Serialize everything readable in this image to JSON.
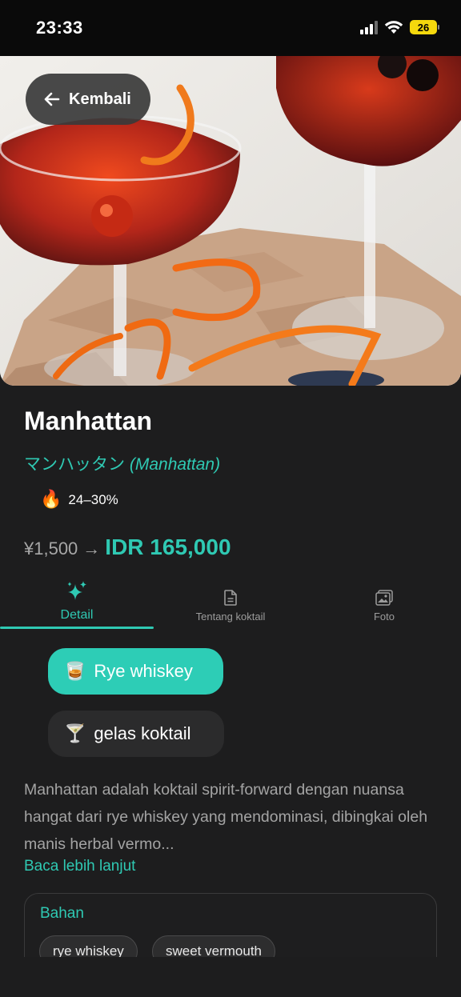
{
  "status_bar": {
    "time": "23:33",
    "battery": "26"
  },
  "back_button": {
    "label": "Kembali"
  },
  "drink": {
    "name": "Manhattan",
    "name_jp": "マンハッタン",
    "name_en": "(Manhattan)",
    "abv": "24–30%",
    "abv_icon": "🔥"
  },
  "price": {
    "original": "¥1,500",
    "arrow": "→",
    "converted": "IDR 165,000"
  },
  "tabs": [
    {
      "label": "Detail",
      "icon": "sparkles-icon",
      "active": true
    },
    {
      "label": "Tentang koktail",
      "icon": "document-icon",
      "active": false
    },
    {
      "label": "Foto",
      "icon": "photo-icon",
      "active": false
    }
  ],
  "chips": {
    "base_spirit": {
      "emoji": "🥃",
      "label": "Rye whiskey"
    },
    "glass": {
      "emoji": "🍸",
      "label": "gelas koktail"
    }
  },
  "description": "Manhattan adalah koktail spirit-forward dengan nuansa hangat dari rye whiskey yang mendominasi, dibingkai oleh manis herbal vermo...",
  "read_more": "Baca lebih lanjut",
  "ingredients": {
    "title": "Bahan",
    "items": [
      "rye whiskey",
      "sweet vermouth"
    ]
  },
  "colors": {
    "accent": "#2fc9b3",
    "background": "#1d1d1e"
  }
}
